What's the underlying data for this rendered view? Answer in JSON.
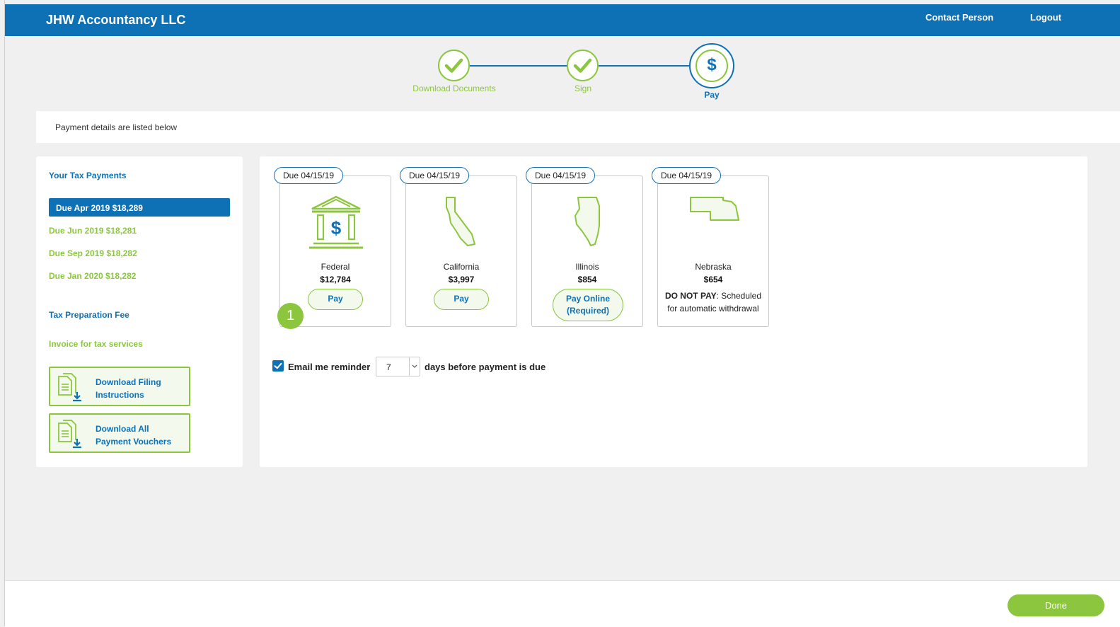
{
  "header": {
    "brand": "JHW Accountancy LLC",
    "contact": "Contact Person",
    "logout": "Logout"
  },
  "stepper": {
    "steps": [
      {
        "label": "Download Documents",
        "state": "complete"
      },
      {
        "label": "Sign",
        "state": "complete"
      },
      {
        "label": "Pay",
        "state": "active",
        "symbol": "$"
      }
    ]
  },
  "info": {
    "message": "Payment details are listed below"
  },
  "sidebar": {
    "title": "Your Tax Payments",
    "items": [
      {
        "label": "Due Apr 2019 $18,289",
        "active": true
      },
      {
        "label": "Due Jun 2019 $18,281"
      },
      {
        "label": "Due Sep 2019 $18,282"
      },
      {
        "label": "Due Jan 2020 $18,282"
      }
    ],
    "fee_title": "Tax Preparation Fee",
    "invoice": "Invoice for tax services",
    "download_filing": "Download Filing Instructions",
    "download_vouchers": "Download All Payment Vouchers"
  },
  "payments": [
    {
      "due": "Due 04/15/19",
      "name": "Federal",
      "amount": "$12,784",
      "action": "Pay",
      "icon": "federal-bank-icon"
    },
    {
      "due": "Due 04/15/19",
      "name": "California",
      "amount": "$3,997",
      "action": "Pay",
      "icon": "california-state-icon"
    },
    {
      "due": "Due 04/15/19",
      "name": "Illinois",
      "amount": "$854",
      "action_line1": "Pay Online",
      "action_line2": "(Required)",
      "icon": "illinois-state-icon"
    },
    {
      "due": "Due 04/15/19",
      "name": "Nebraska",
      "amount": "$654",
      "note_bold": "DO NOT PAY",
      "note_rest": ": Scheduled",
      "note_line2": "for automatic withdrawal",
      "icon": "nebraska-state-icon"
    }
  ],
  "badge": "1",
  "reminder": {
    "checked": true,
    "label": "Email me reminder",
    "days": "7",
    "suffix": "days before payment is due"
  },
  "footer": {
    "done": "Done"
  },
  "colors": {
    "brand_blue": "#0f71b5",
    "accent_green": "#8cc63f"
  }
}
